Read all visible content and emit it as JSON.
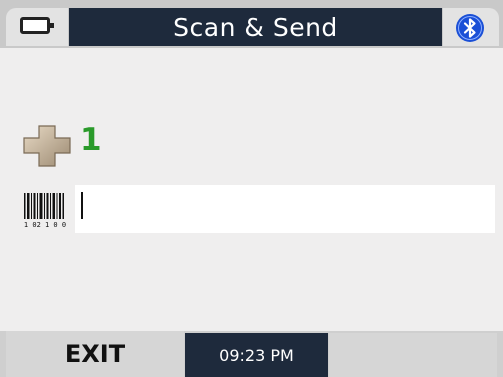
{
  "header": {
    "title": "Scan & Send",
    "left_icon": "battery-icon",
    "right_icon": "bluetooth-icon"
  },
  "main": {
    "scan_count": "1",
    "count_icon": "plus-icon",
    "barcode_icon": "barcode-icon",
    "barcode_digits": "1 02 1 0 0",
    "input": {
      "value": "",
      "placeholder": ""
    }
  },
  "footer": {
    "exit_label": "EXIT",
    "time": "09:23 PM"
  },
  "colors": {
    "title_bar": "#1e2a3c",
    "count_green": "#2a9a2a",
    "bluetooth_blue": "#1a4fd6"
  }
}
